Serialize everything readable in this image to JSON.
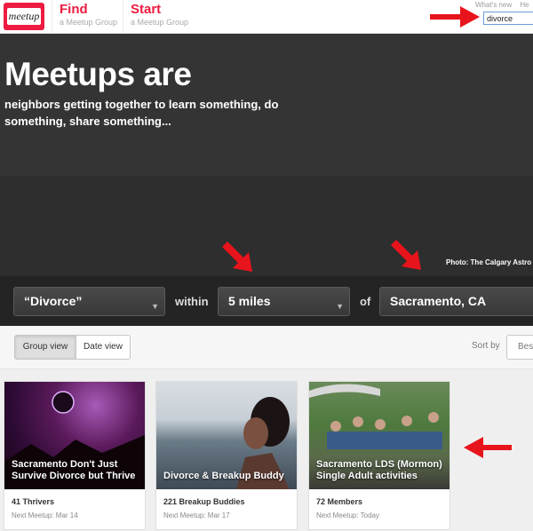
{
  "header": {
    "logo_text": "meetup",
    "find_title": "Find",
    "find_sub": "a Meetup Group",
    "start_title": "Start",
    "start_sub": "a Meetup Group",
    "top_links": [
      "What's new",
      "He"
    ],
    "search_value": "divorce",
    "search_placeholder": "Search"
  },
  "hero": {
    "title": "Meetups are",
    "subtitle": "neighbors getting together to learn something, do something, share something...",
    "photo_credit": "Photo: The Calgary Astro"
  },
  "filters": {
    "topic": "“Divorce”",
    "within_label": "within",
    "distance": "5 miles",
    "of_label": "of",
    "location": "Sacramento, CA"
  },
  "view": {
    "group_view": "Group view",
    "date_view": "Date view",
    "sort_label": "Sort by",
    "sort_value": "Best"
  },
  "cards": [
    {
      "title": "Sacramento Don't Just Survive Divorce but Thrive",
      "members": "41 Thrivers",
      "next": "Next Meetup: Mar 14"
    },
    {
      "title": "Divorce & Breakup Buddy",
      "members": "221 Breakup Buddies",
      "next": "Next Meetup: Mar 17"
    },
    {
      "title": "Sacramento LDS (Mormon) Single Adult activities",
      "members": "72 Members",
      "next": "Next Meetup: Today"
    }
  ],
  "colors": {
    "brand": "#ed1c40",
    "annotation_arrow": "#e8141c"
  }
}
